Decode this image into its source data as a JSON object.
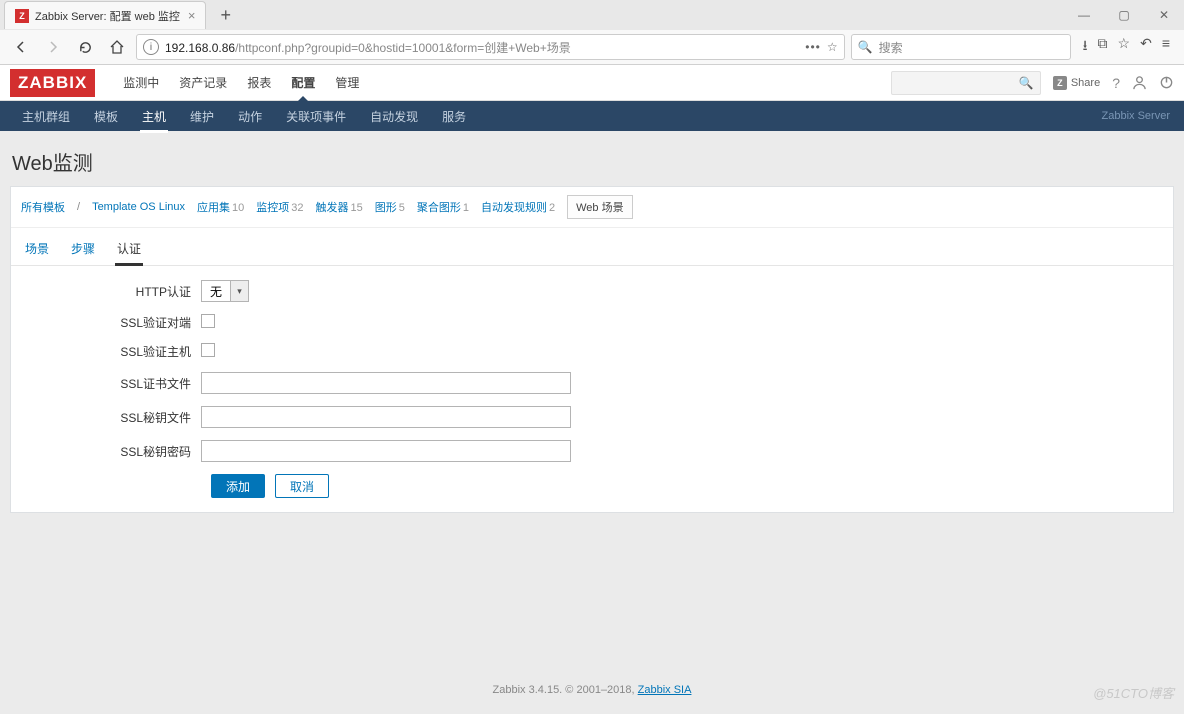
{
  "browser": {
    "tab_title": "Zabbix Server: 配置 web 监控",
    "url_prefix": "192.168.0.86",
    "url_rest": "/httpconf.php?groupid=0&hostid=10001&form=创建+Web+场景",
    "search_placeholder": "搜索"
  },
  "zabbix": {
    "logo": "ZABBIX",
    "top_menu": [
      "监测中",
      "资产记录",
      "报表",
      "配置",
      "管理"
    ],
    "top_menu_active_index": 3,
    "share_label": "Share",
    "sub_nav": [
      "主机群组",
      "模板",
      "主机",
      "维护",
      "动作",
      "关联项事件",
      "自动发现",
      "服务"
    ],
    "sub_nav_active_index": 2,
    "sub_nav_right": "Zabbix Server"
  },
  "page": {
    "title": "Web监测",
    "breadcrumbs": {
      "root": "所有模板",
      "template": "Template OS Linux",
      "items": [
        {
          "label": "应用集",
          "count": "10"
        },
        {
          "label": "监控项",
          "count": "32"
        },
        {
          "label": "触发器",
          "count": "15"
        },
        {
          "label": "图形",
          "count": "5"
        },
        {
          "label": "聚合图形",
          "count": "1"
        },
        {
          "label": "自动发现规则",
          "count": "2"
        }
      ],
      "active": "Web 场景"
    },
    "tabs": [
      "场景",
      "步骤",
      "认证"
    ],
    "tabs_active_index": 2,
    "form": {
      "http_auth_label": "HTTP认证",
      "http_auth_value": "无",
      "ssl_verify_peer_label": "SSL验证对端",
      "ssl_verify_host_label": "SSL验证主机",
      "ssl_cert_file_label": "SSL证书文件",
      "ssl_cert_file_value": "",
      "ssl_key_file_label": "SSL秘钥文件",
      "ssl_key_file_value": "",
      "ssl_key_password_label": "SSL秘钥密码",
      "ssl_key_password_value": "",
      "submit_label": "添加",
      "cancel_label": "取消"
    }
  },
  "footer": {
    "text_prefix": "Zabbix 3.4.15. © 2001–2018, ",
    "link": "Zabbix SIA"
  },
  "watermark": "@51CTO博客"
}
